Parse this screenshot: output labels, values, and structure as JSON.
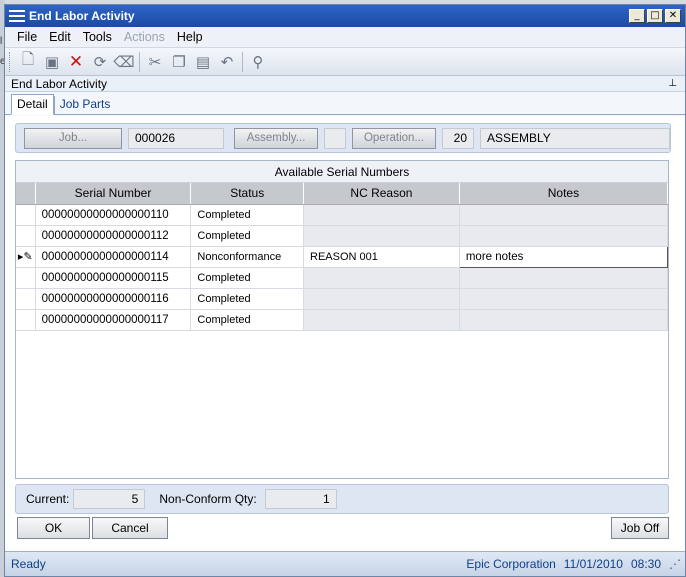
{
  "window": {
    "title": "End Labor Activity"
  },
  "menu": [
    "File",
    "Edit",
    "Tools",
    "Actions",
    "Help"
  ],
  "toolbar_icons": [
    "new-icon",
    "save-icon",
    "delete-icon",
    "refresh-icon",
    "clear-icon",
    "cut-icon",
    "copy-icon",
    "paste-icon",
    "undo-icon",
    "find-icon"
  ],
  "panel": {
    "title": "End Labor Activity"
  },
  "tabs": [
    "Detail",
    "Job Parts"
  ],
  "job": {
    "job_button": "Job...",
    "job_value": "000026",
    "assembly_button": "Assembly...",
    "assembly_value": "",
    "operation_button": "Operation...",
    "operation_seq": "20",
    "operation_desc": "ASSEMBLY"
  },
  "grid": {
    "caption": "Available Serial Numbers",
    "columns": [
      "Serial Number",
      "Status",
      "NC Reason",
      "Notes"
    ],
    "rows": [
      {
        "serial": "00000000000000000110",
        "status": "Completed",
        "nc_reason": "",
        "notes": ""
      },
      {
        "serial": "00000000000000000112",
        "status": "Completed",
        "nc_reason": "",
        "notes": ""
      },
      {
        "serial": "00000000000000000114",
        "status": "Nonconformance",
        "nc_reason": "REASON 001",
        "notes": "more notes"
      },
      {
        "serial": "00000000000000000115",
        "status": "Completed",
        "nc_reason": "",
        "notes": ""
      },
      {
        "serial": "00000000000000000116",
        "status": "Completed",
        "nc_reason": "",
        "notes": ""
      },
      {
        "serial": "00000000000000000117",
        "status": "Completed",
        "nc_reason": "",
        "notes": ""
      }
    ]
  },
  "counts": {
    "current_label": "Current:",
    "current_value": "5",
    "nc_label": "Non-Conform Qty:",
    "nc_value": "1"
  },
  "buttons": {
    "ok": "OK",
    "cancel": "Cancel",
    "job_off": "Job Off"
  },
  "status": {
    "text": "Ready",
    "company": "Epic Corporation",
    "date": "11/01/2010",
    "time": "08:30"
  }
}
